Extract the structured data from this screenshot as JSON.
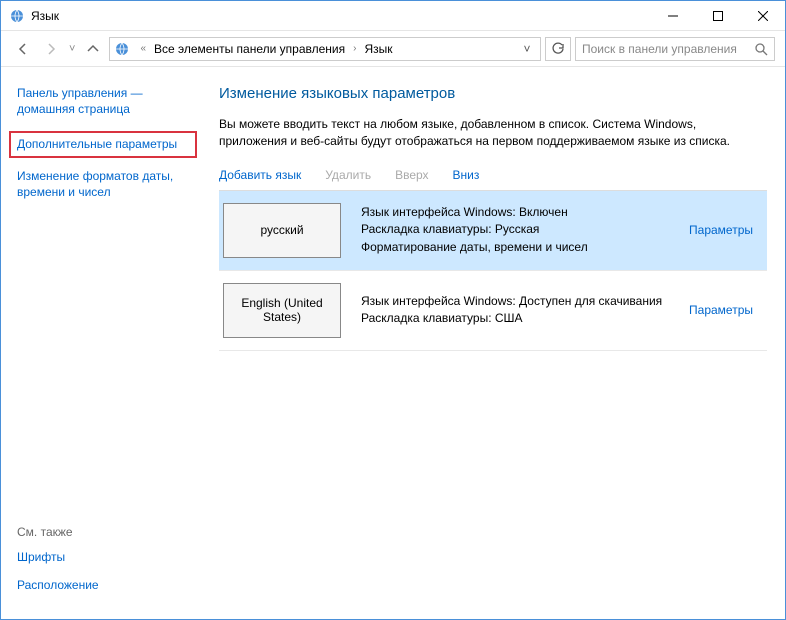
{
  "window": {
    "title": "Язык"
  },
  "breadcrumb": {
    "seg1": "Все элементы панели управления",
    "seg2": "Язык"
  },
  "search": {
    "placeholder": "Поиск в панели управления"
  },
  "sidebar": {
    "home": "Панель управления — домашняя страница",
    "advanced": "Дополнительные параметры",
    "formats": "Изменение форматов даты, времени и чисел",
    "see_also_label": "См. также",
    "fonts": "Шрифты",
    "location": "Расположение"
  },
  "main": {
    "heading": "Изменение языковых параметров",
    "description": "Вы можете вводить текст на любом языке, добавленном в список. Система Windows, приложения и веб-сайты будут отображаться на первом поддерживаемом языке из списка."
  },
  "toolbar": {
    "add": "Добавить язык",
    "remove": "Удалить",
    "up": "Вверх",
    "down": "Вниз"
  },
  "languages": [
    {
      "name": "русский",
      "line1": "Язык интерфейса Windows: Включен",
      "line2": "Раскладка клавиатуры: Русская",
      "line3": "Форматирование даты, времени и чисел",
      "options": "Параметры"
    },
    {
      "name": "English (United States)",
      "line1": "Язык интерфейса Windows: Доступен для скачивания",
      "line2": "Раскладка клавиатуры: США",
      "line3": "",
      "options": "Параметры"
    }
  ]
}
